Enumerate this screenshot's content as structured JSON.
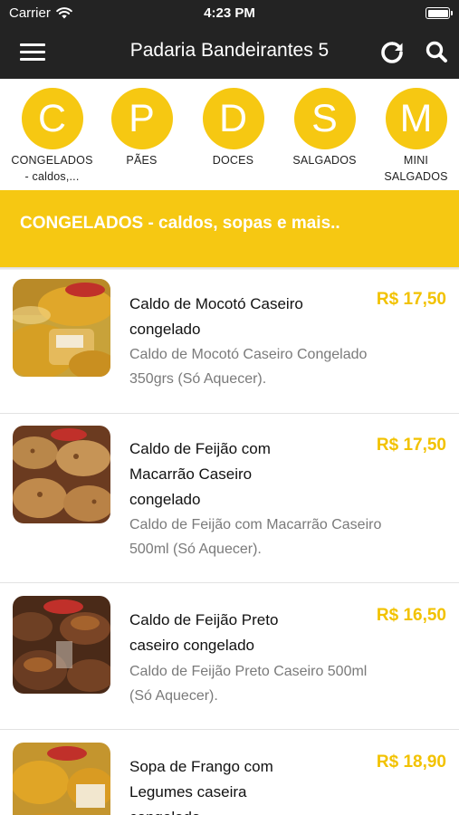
{
  "status_bar": {
    "carrier": "Carrier",
    "time": "4:23 PM",
    "battery_level": 1.0
  },
  "nav": {
    "title": "Padaria Bandeirantes 5",
    "icons": [
      "menu-icon",
      "refresh-icon",
      "search-icon"
    ]
  },
  "categories": [
    {
      "letter": "C",
      "label_line1": "CONGELADOS",
      "label_line2": "- caldos,..."
    },
    {
      "letter": "P",
      "label_line1": "PÃES",
      "label_line2": ""
    },
    {
      "letter": "D",
      "label_line1": "DOCES",
      "label_line2": ""
    },
    {
      "letter": "S",
      "label_line1": "SALGADOS",
      "label_line2": ""
    },
    {
      "letter": "M",
      "label_line1": "MINI",
      "label_line2": "SALGADOS"
    }
  ],
  "section": {
    "title": "CONGELADOS - caldos, sopas e mais.."
  },
  "products": [
    {
      "name_lines": [
        "Caldo de Mocotó Caseiro",
        "congelado"
      ],
      "price": "R$ 17,50",
      "desc_lines": [
        "Caldo de Mocotó Caseiro Congelado",
        "350grs (Só Aquecer)."
      ]
    },
    {
      "name_lines": [
        "Caldo de Feijão com",
        "Macarrão Caseiro",
        "congelado"
      ],
      "price": "R$ 17,50",
      "desc_lines": [
        "Caldo de Feijão com Macarrão Caseiro",
        "500ml (Só Aquecer)."
      ]
    },
    {
      "name_lines": [
        "Caldo de Feijão Preto",
        "caseiro congelado"
      ],
      "price": "R$ 16,50",
      "desc_lines": [
        "Caldo de Feijão Preto Caseiro 500ml",
        "(Só Aquecer)."
      ]
    },
    {
      "name_lines": [
        "Sopa de Frango com",
        "Legumes caseira",
        "congelada"
      ],
      "price": "R$ 18,90",
      "desc_lines": []
    }
  ],
  "colors": {
    "nav_bg": "#232323",
    "accent": "#f6c812",
    "price": "#f2c200",
    "desc": "#7a7a7a"
  }
}
